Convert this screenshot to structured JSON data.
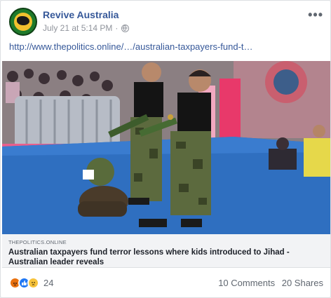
{
  "post": {
    "page_name": "Revive Australia",
    "timestamp": "July 21 at 5:14 PM",
    "separator": "·",
    "link_text": "http://www.thepolitics.online/…/australian-taxpayers-fund-t…",
    "more_icon": "more-options-icon",
    "privacy_icon": "globe-icon"
  },
  "link_preview": {
    "domain": "THEPOLITICS.ONLINE",
    "headline": "Australian taxpayers fund terror lessons where kids introduced to Jihad - Australian leader reveals"
  },
  "engagement": {
    "reaction_icons": [
      "angry-reaction-icon",
      "like-reaction-icon",
      "sad-reaction-icon"
    ],
    "reaction_count": "24",
    "comments": "10 Comments",
    "shares": "20 Shares"
  },
  "colors": {
    "link": "#365899",
    "stage_blue": "#2f6fc0",
    "angry": "#e9710f",
    "like": "#2078f4",
    "sad": "#f7c33b"
  }
}
